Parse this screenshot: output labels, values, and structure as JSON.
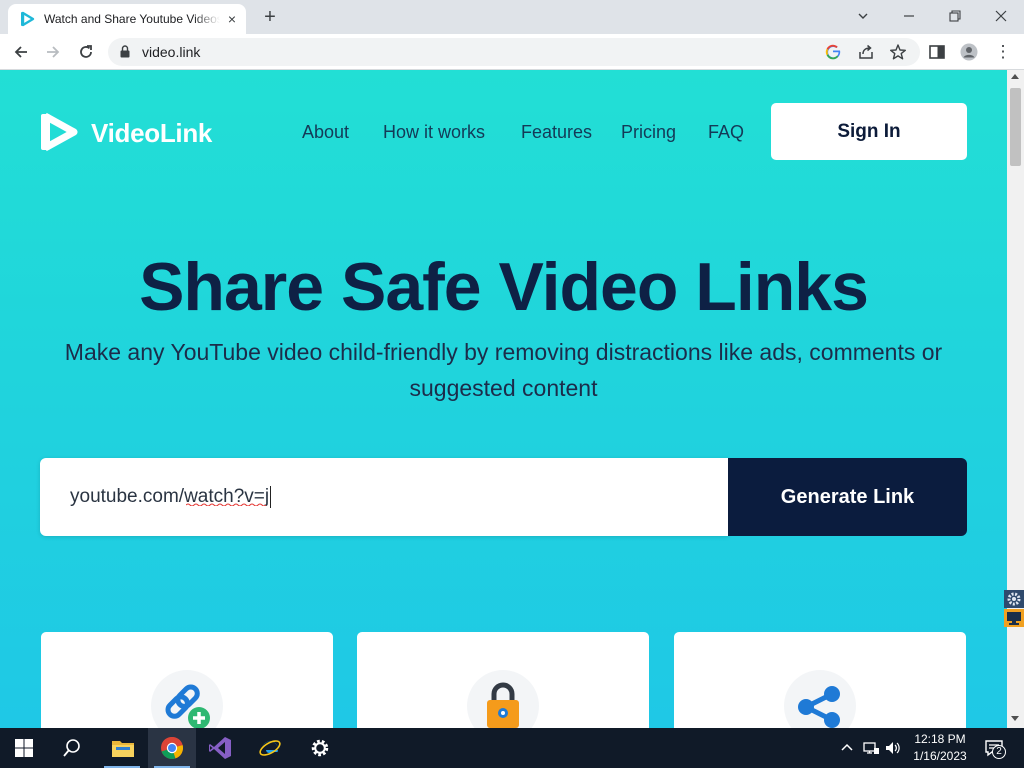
{
  "browser": {
    "tab_title": "Watch and Share Youtube Videos",
    "tab_close": "×",
    "new_tab": "+",
    "window_minimize": "—",
    "window_restore": "❐",
    "window_close": "✕",
    "tabs_menu": "⌄",
    "back": "←",
    "forward": "→",
    "reload": "↻",
    "url": "video.link",
    "menu": "⋮"
  },
  "page": {
    "logo_text": "VideoLink",
    "nav": [
      "About",
      "How it works",
      "Features",
      "Pricing",
      "FAQ"
    ],
    "signin_label": "Sign In",
    "hero_title": "Share Safe Video Links",
    "hero_subtitle": "Make any YouTube video child-friendly by removing distractions like ads, comments or suggested content",
    "url_input_value": "youtube.com/watch?v=j",
    "generate_label": "Generate Link",
    "cards": [
      {
        "icon": "link-add-icon"
      },
      {
        "icon": "padlock-icon"
      },
      {
        "icon": "share-icon"
      }
    ]
  },
  "taskbar": {
    "time": "12:18 PM",
    "date": "1/16/2023",
    "notification_count": "2",
    "apps": [
      "windows-start",
      "search",
      "file-explorer",
      "chrome",
      "visual-studio",
      "internet-explorer",
      "settings"
    ]
  },
  "colors": {
    "brand_cyan": "#22dfd5",
    "brand_navy": "#0b1c3e",
    "nav_text": "#143a57"
  }
}
